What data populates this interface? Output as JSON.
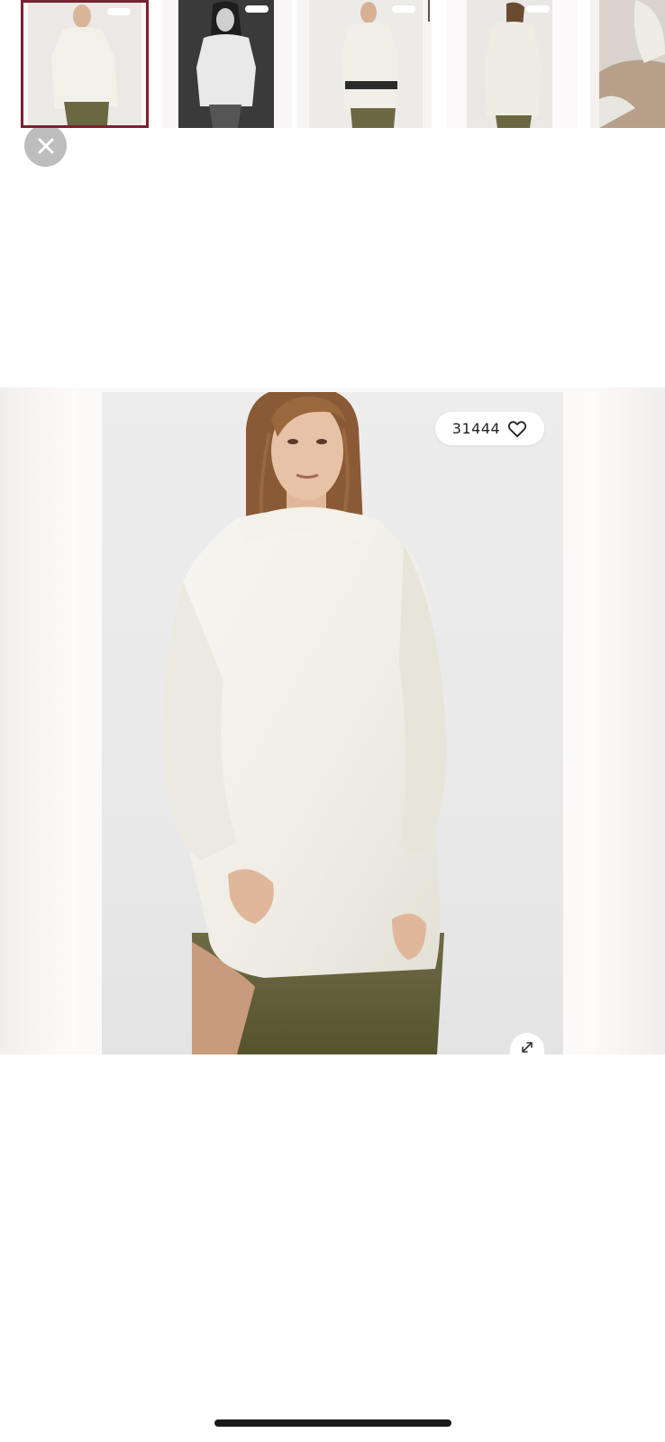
{
  "viewer": {
    "close_icon": "close-icon",
    "like_count": "31444",
    "like_icon": "heart-outline-icon",
    "expand_icon": "expand-diagonal-icon"
  },
  "gallery": {
    "selected_index": 1,
    "thumbnail_count": 5,
    "accent_color": "#7a2233"
  },
  "colors": {
    "close_button_bg": "#bdbdbd",
    "home_indicator": "#1a1a1a"
  }
}
